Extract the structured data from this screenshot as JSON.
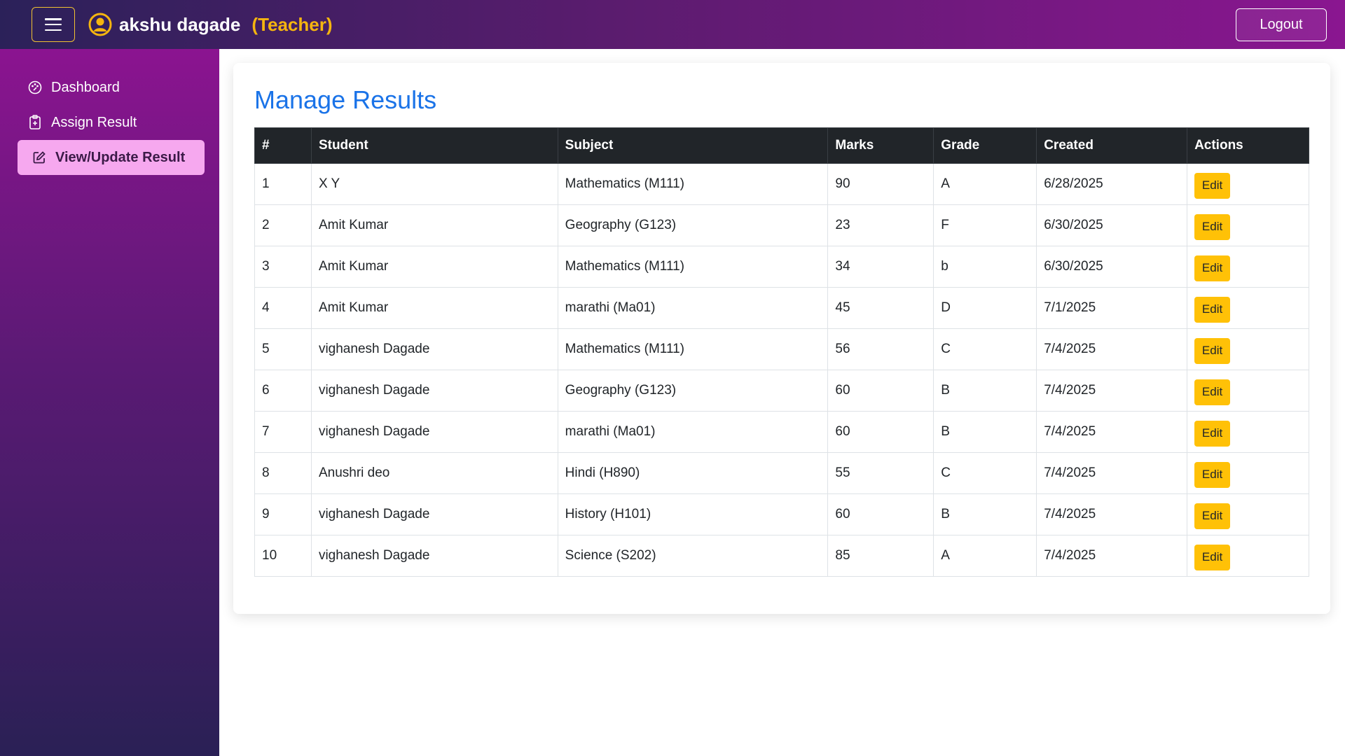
{
  "header": {
    "user_name": "akshu dagade",
    "user_role": "(Teacher)",
    "logout_label": "Logout",
    "menu_icon": "hamburger-icon",
    "user_icon": "user-circle-icon"
  },
  "sidebar": {
    "items": [
      {
        "label": "Dashboard",
        "icon": "palette-icon",
        "active": false
      },
      {
        "label": "Assign Result",
        "icon": "clipboard-plus-icon",
        "active": false
      },
      {
        "label": "View/Update Result",
        "icon": "edit-icon",
        "active": true
      }
    ]
  },
  "main": {
    "title": "Manage Results",
    "columns": [
      "#",
      "Student",
      "Subject",
      "Marks",
      "Grade",
      "Created",
      "Actions"
    ],
    "rows": [
      {
        "num": "1",
        "student": "X Y",
        "subject": "Mathematics (M111)",
        "marks": "90",
        "grade": "A",
        "created": "6/28/2025",
        "action": "Edit"
      },
      {
        "num": "2",
        "student": "Amit Kumar",
        "subject": "Geography (G123)",
        "marks": "23",
        "grade": "F",
        "created": "6/30/2025",
        "action": "Edit"
      },
      {
        "num": "3",
        "student": "Amit Kumar",
        "subject": "Mathematics (M111)",
        "marks": "34",
        "grade": "b",
        "created": "6/30/2025",
        "action": "Edit"
      },
      {
        "num": "4",
        "student": "Amit Kumar",
        "subject": "marathi (Ma01)",
        "marks": "45",
        "grade": "D",
        "created": "7/1/2025",
        "action": "Edit"
      },
      {
        "num": "5",
        "student": "vighanesh Dagade",
        "subject": "Mathematics (M111)",
        "marks": "56",
        "grade": "C",
        "created": "7/4/2025",
        "action": "Edit"
      },
      {
        "num": "6",
        "student": "vighanesh Dagade",
        "subject": "Geography (G123)",
        "marks": "60",
        "grade": "B",
        "created": "7/4/2025",
        "action": "Edit"
      },
      {
        "num": "7",
        "student": "vighanesh Dagade",
        "subject": "marathi (Ma01)",
        "marks": "60",
        "grade": "B",
        "created": "7/4/2025",
        "action": "Edit"
      },
      {
        "num": "8",
        "student": "Anushri deo",
        "subject": "Hindi (H890)",
        "marks": "55",
        "grade": "C",
        "created": "7/4/2025",
        "action": "Edit"
      },
      {
        "num": "9",
        "student": "vighanesh Dagade",
        "subject": "History (H101)",
        "marks": "60",
        "grade": "B",
        "created": "7/4/2025",
        "action": "Edit"
      },
      {
        "num": "10",
        "student": "vighanesh Dagade",
        "subject": "Science (S202)",
        "marks": "85",
        "grade": "A",
        "created": "7/4/2025",
        "action": "Edit"
      }
    ]
  },
  "colors": {
    "title": "#1a73e8",
    "accent_yellow": "#ffc107",
    "table_header": "#212529",
    "active_nav": "#f6a8ef"
  }
}
